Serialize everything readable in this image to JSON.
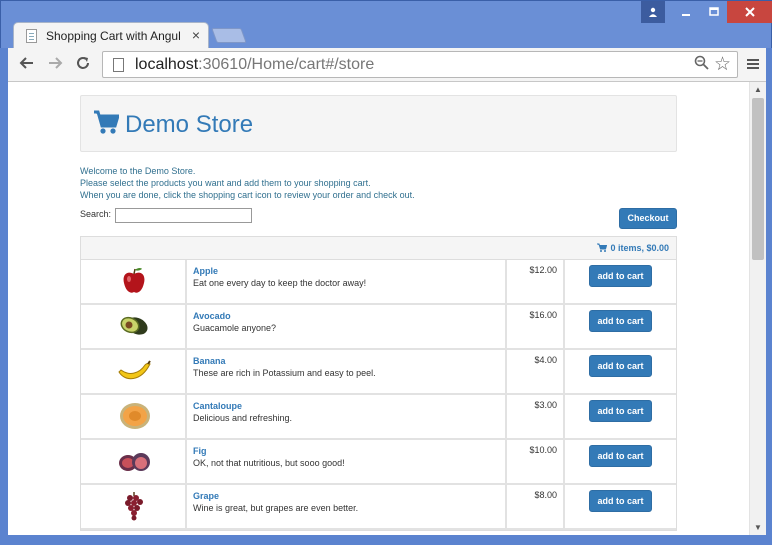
{
  "browser": {
    "tab_title": "Shopping Cart with Angul",
    "tab_close": "×",
    "url_host": "localhost",
    "url_path": ":30610/Home/cart#/store",
    "icons": [
      "page-icon",
      "back-icon",
      "forward-icon",
      "reload-icon",
      "document-icon",
      "zoom-icon",
      "star-icon",
      "menu-icon",
      "user-icon",
      "minimize-icon",
      "maximize-icon",
      "close-icon"
    ]
  },
  "store": {
    "title": "Demo Store",
    "welcome_lines": [
      "Welcome to the Demo Store.",
      "Please select the products you want and add them to your shopping cart.",
      "When you are done, click the shopping cart icon to review your order and check out."
    ],
    "search_label": "Search:",
    "search_value": "",
    "checkout_label": "Checkout",
    "cart_summary": "0 items, $0.00",
    "accent_color": "#337ab7"
  },
  "products": [
    {
      "name": "Apple",
      "description": "Eat one every day to keep the doctor away!",
      "price": "$12.00",
      "button": "add to cart",
      "image": "apple"
    },
    {
      "name": "Avocado",
      "description": "Guacamole anyone?",
      "price": "$16.00",
      "button": "add to cart",
      "image": "avocado"
    },
    {
      "name": "Banana",
      "description": "These are rich in Potassium and easy to peel.",
      "price": "$4.00",
      "button": "add to cart",
      "image": "banana"
    },
    {
      "name": "Cantaloupe",
      "description": "Delicious and refreshing.",
      "price": "$3.00",
      "button": "add to cart",
      "image": "cantaloupe"
    },
    {
      "name": "Fig",
      "description": "OK, not that nutritious, but sooo good!",
      "price": "$10.00",
      "button": "add to cart",
      "image": "fig"
    },
    {
      "name": "Grape",
      "description": "Wine is great, but grapes are even better.",
      "price": "$8.00",
      "button": "add to cart",
      "image": "grape"
    }
  ]
}
